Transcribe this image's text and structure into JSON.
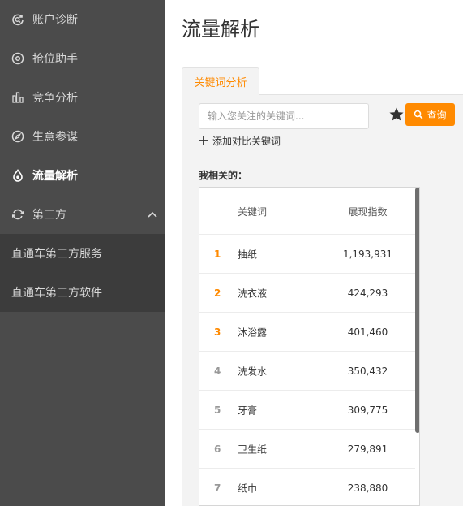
{
  "sidebar": {
    "items": [
      {
        "label": "账户诊断",
        "icon": "diagnosis-icon"
      },
      {
        "label": "抢位助手",
        "icon": "target-icon"
      },
      {
        "label": "竞争分析",
        "icon": "bar-chart-icon"
      },
      {
        "label": "生意参谋",
        "icon": "compass-icon"
      },
      {
        "label": "流量解析",
        "icon": "flame-icon",
        "active": true
      },
      {
        "label": "第三方",
        "icon": "loop-icon",
        "expanded": true
      }
    ],
    "sub_items": [
      {
        "label": "直通车第三方服务"
      },
      {
        "label": "直通车第三方软件"
      }
    ]
  },
  "main": {
    "title": "流量解析",
    "tab_label": "关键词分析",
    "search": {
      "placeholder": "输入您关注的关键词...",
      "value": ""
    },
    "query_label": "查询",
    "add_compare_label": "添加对比关键词",
    "section_label": "我相关的：",
    "table": {
      "headers": [
        "关键词",
        "展现指数"
      ],
      "rows": [
        {
          "rank": "1",
          "keyword": "抽纸",
          "value": "1,193,931"
        },
        {
          "rank": "2",
          "keyword": "洗衣液",
          "value": "424,293"
        },
        {
          "rank": "3",
          "keyword": "沐浴露",
          "value": "401,460"
        },
        {
          "rank": "4",
          "keyword": "洗发水",
          "value": "350,432"
        },
        {
          "rank": "5",
          "keyword": "牙膏",
          "value": "309,775"
        },
        {
          "rank": "6",
          "keyword": "卫生纸",
          "value": "279,891"
        },
        {
          "rank": "7",
          "keyword": "纸巾",
          "value": "238,880"
        }
      ]
    }
  },
  "colors": {
    "accent": "#ff8a00",
    "sidebar_bg": "#4b4b4b",
    "submenu_bg": "#3c3c3c"
  }
}
